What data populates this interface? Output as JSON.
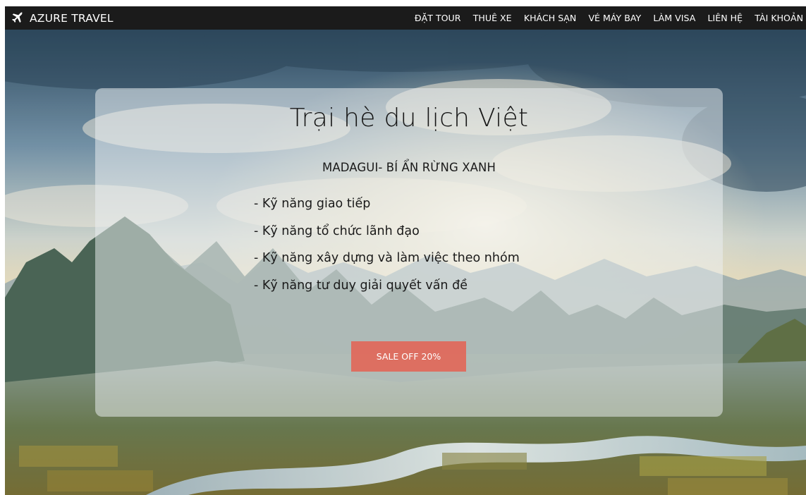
{
  "navbar": {
    "brand_icon": "plane-icon",
    "brand_name": "AZURE TRAVEL",
    "menu": [
      {
        "label": "ĐẶT TOUR"
      },
      {
        "label": "THUÊ XE"
      },
      {
        "label": "KHÁCH SẠN"
      },
      {
        "label": "VÉ MÁY BAY"
      },
      {
        "label": "LÀM VISA"
      },
      {
        "label": "LIÊN HỆ"
      },
      {
        "label": "TÀI KHOẢN"
      }
    ],
    "background_color": "#1b1b1b",
    "text_color": "#ffffff"
  },
  "hero": {
    "background": "landscape-photo-mountains-river-sunrise",
    "panel": {
      "title": "Trại hè du lịch Việt",
      "subtitle": "MADAGUI- BÍ ẨN RỪNG XANH",
      "skills": [
        "- Kỹ năng giao tiếp",
        "- Kỹ năng tổ chức lãnh đạo",
        "- Kỹ năng xây dựng và làm việc theo nhóm",
        "- Kỹ năng tư duy giải quyết vấn đề"
      ],
      "cta_label": "SALE OFF 20%",
      "cta_color": "#e26658"
    }
  }
}
